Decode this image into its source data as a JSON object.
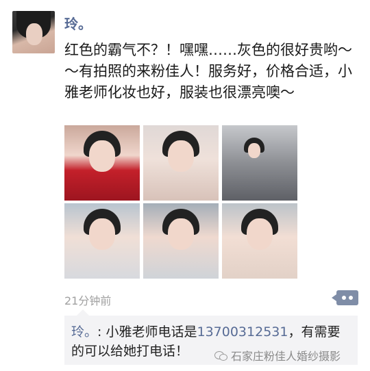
{
  "post": {
    "username": "玲。",
    "text": "红色的霸气不？！嘿嘿……灰色的很好贵哟～～有拍照的来粉佳人！服务好，价格合适，小雅老师化妆也好，服装也很漂亮噢～",
    "time": "21分钟前"
  },
  "photos": [
    {
      "name": "photo-1"
    },
    {
      "name": "photo-2"
    },
    {
      "name": "photo-3"
    },
    {
      "name": "photo-4"
    },
    {
      "name": "photo-5"
    },
    {
      "name": "photo-6"
    }
  ],
  "comment": {
    "author": "玲。",
    "separator": ": ",
    "text_before": "小雅老师电话是",
    "phone": "13700312531",
    "text_after": "，有需要的可以给她打电话！"
  },
  "watermark": {
    "text": "石家庄粉佳人婚纱摄影",
    "icon": "wechat-icon"
  },
  "icons": {
    "comment_button": "more-comment-icon"
  },
  "colors": {
    "link_blue": "#576b95",
    "comment_bg": "#f3f3f5",
    "timestamp_gray": "#a0a0a0",
    "button_bg": "#7f8da7"
  }
}
